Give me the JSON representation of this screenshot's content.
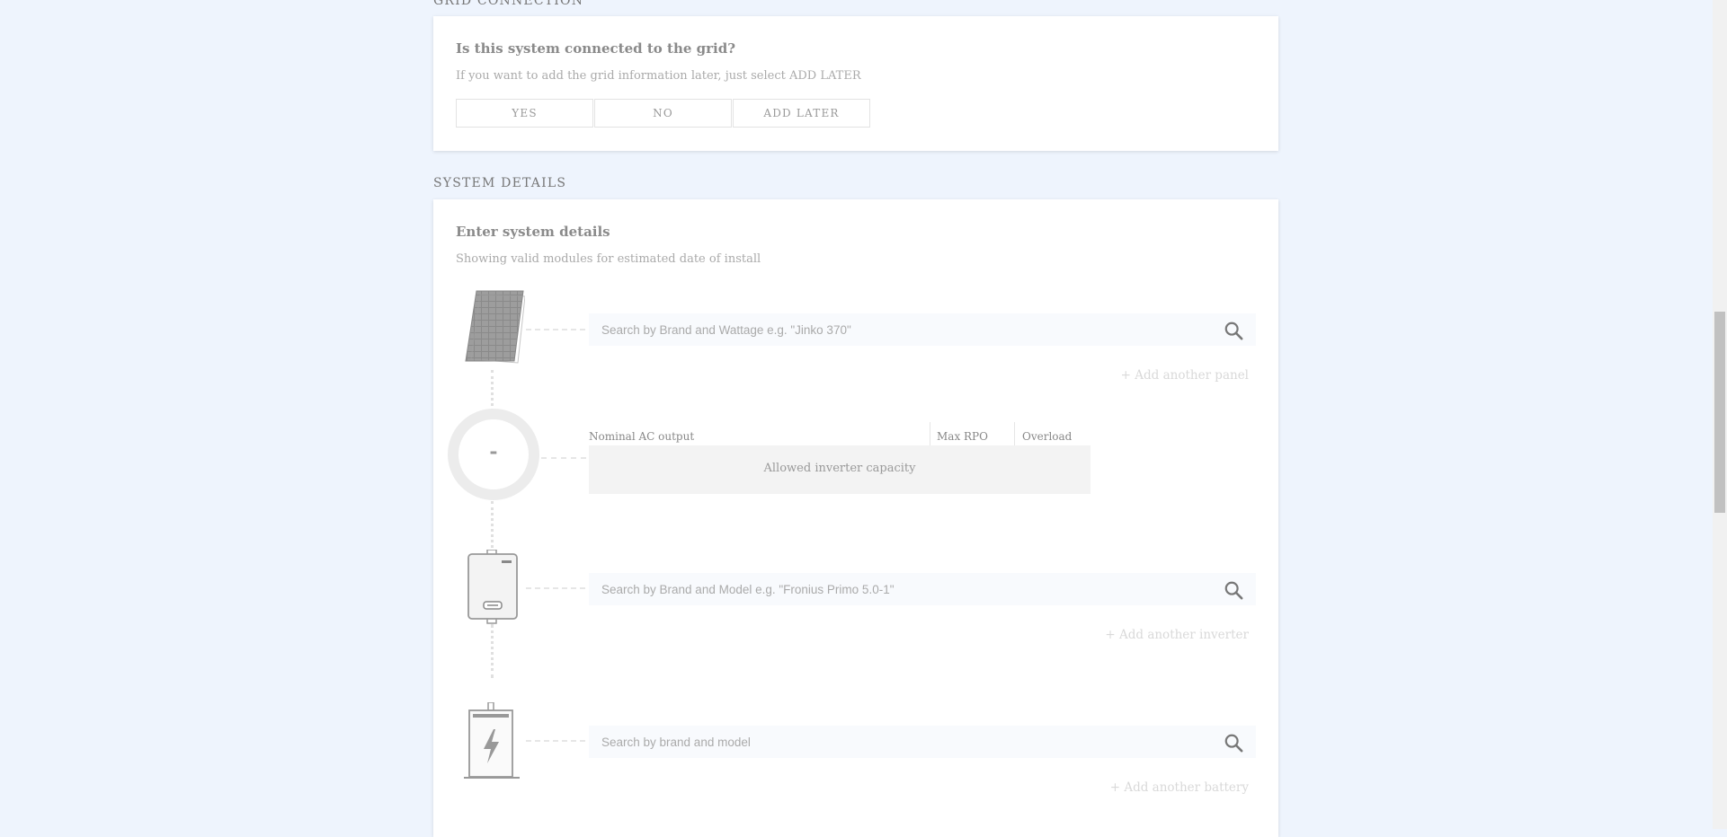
{
  "grid": {
    "section_heading": "GRID CONNECTION",
    "question": "Is this system connected to the grid?",
    "hint": "If you want to add the grid information later, just select ADD LATER",
    "options": [
      "YES",
      "NO",
      "ADD LATER"
    ]
  },
  "system": {
    "section_heading": "SYSTEM DETAILS",
    "title": "Enter system details",
    "subtitle": "Showing valid modules for estimated date of install",
    "panel_search": {
      "placeholder": "Search by Brand and Wattage e.g. \"Jinko 370\"",
      "add_link": "+ Add another panel"
    },
    "capacity": {
      "dial_value": "-",
      "col_nominal": "Nominal AC output",
      "col_max_rpo": "Max RPO",
      "col_overload": "Overload",
      "allowed_label": "Allowed inverter capacity"
    },
    "inverter_search": {
      "placeholder": "Search by Brand and Model e.g. \"Fronius Primo 5.0-1\"",
      "add_link": "+ Add another inverter"
    },
    "battery_search": {
      "placeholder": "Search by brand and model",
      "add_link": "+ Add another battery"
    }
  },
  "colors": {
    "page_bg": "#eef4fd",
    "card_bg": "#ffffff",
    "search_bg": "#f8fafd",
    "muted_text": "#aaaaaa"
  },
  "icons": [
    "solar-panel-icon",
    "capacity-dial-icon",
    "inverter-icon",
    "battery-icon",
    "search-icon"
  ]
}
